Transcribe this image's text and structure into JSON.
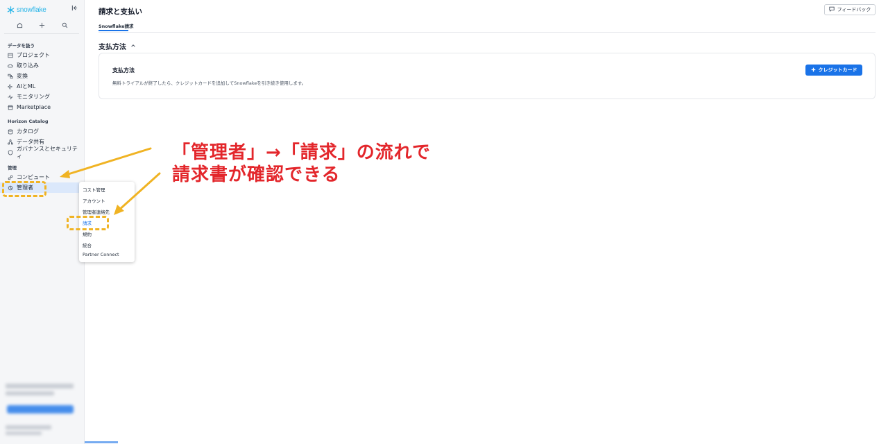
{
  "app": {
    "logo_text": "snowflake",
    "brand_color": "#29b5e8",
    "accent_color": "#1a73e8"
  },
  "sidebar": {
    "section_data": "データを扱う",
    "data_items": [
      {
        "label": "プロジェクト",
        "icon": "folder-icon"
      },
      {
        "label": "取り込み",
        "icon": "cloud-upload-icon"
      },
      {
        "label": "変換",
        "icon": "transform-icon"
      },
      {
        "label": "AIとML",
        "icon": "sparkle-icon"
      },
      {
        "label": "モニタリング",
        "icon": "activity-icon"
      },
      {
        "label": "Marketplace",
        "icon": "store-icon"
      }
    ],
    "section_horizon": "Horizon Catalog",
    "horizon_items": [
      {
        "label": "カタログ",
        "icon": "database-icon"
      },
      {
        "label": "データ共有",
        "icon": "share-icon"
      },
      {
        "label": "ガバナンスとセキュリティ",
        "icon": "shield-icon"
      }
    ],
    "section_admin": "管理",
    "admin_items": [
      {
        "label": "コンピュート",
        "icon": "compute-icon"
      },
      {
        "label": "管理者",
        "icon": "admin-icon",
        "active": true
      }
    ]
  },
  "header": {
    "title": "請求と支払い",
    "feedback_label": "フィードバック",
    "tab_label": "Snowflake請求"
  },
  "payment": {
    "section_title": "支払方法",
    "card_title": "支払方法",
    "card_desc": "無料トライアルが終了したら、クレジットカードを追加してSnowflakeを引き続き使用します。",
    "add_card_label": "クレジットカード"
  },
  "admin_menu": {
    "items": [
      "コスト管理",
      "アカウント",
      "管理者連絡先",
      "請求",
      "規約",
      "統合",
      "Partner Connect"
    ],
    "current": "請求"
  },
  "annotation": {
    "line1": "「管理者」→「請求」の流れで",
    "line2": "請求書が確認できる",
    "text_color": "#e3262b",
    "highlight_color": "#f0b323"
  }
}
